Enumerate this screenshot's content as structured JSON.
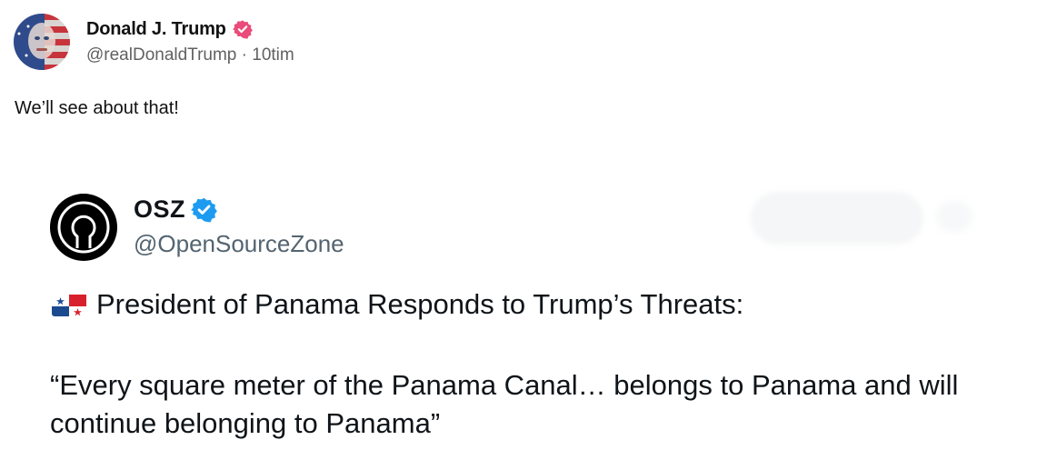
{
  "post": {
    "author": {
      "display_name": "Donald J. Trump",
      "handle": "@realDonaldTrump",
      "separator": "·",
      "time": "10tim",
      "verified_color": "#e94c7a",
      "avatar_icon": "flag-portrait-avatar"
    },
    "text": "We’ll see about that!"
  },
  "quoted": {
    "author": {
      "display_name": "OSZ",
      "handle": "@OpenSourceZone",
      "verified_color": "#1d9bf0",
      "avatar_icon": "open-source-logo"
    },
    "headline": "President of Panama Responds to Trump’s Threats:",
    "flag_icon": "panama-flag-emoji",
    "quote": "“Every square meter of the Panama Canal… belongs to Panama and will continue belonging to Panama”"
  }
}
